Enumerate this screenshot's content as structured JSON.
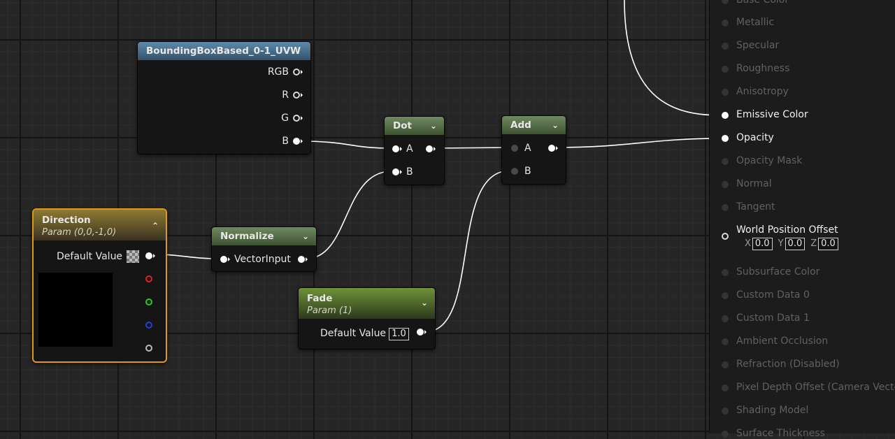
{
  "nodes": {
    "bbox": {
      "title": "BoundingBoxBased_0-1_UVW",
      "outputs": [
        "RGB",
        "R",
        "G",
        "B"
      ],
      "header_color": "#4a6f8a"
    },
    "dot": {
      "title": "Dot",
      "inputs": [
        "A",
        "B"
      ],
      "header_color": "#55694a"
    },
    "add": {
      "title": "Add",
      "inputs": [
        "A",
        "B"
      ],
      "header_color": "#55694a"
    },
    "direction": {
      "title": "Direction",
      "subtitle": "Param (0,0,-1,0)",
      "default_label": "Default Value",
      "header_color": "#7a6a2a",
      "border_color": "#e0981c"
    },
    "normalize": {
      "title": "Normalize",
      "input": "VectorInput",
      "header_color": "#55694a"
    },
    "fade": {
      "title": "Fade",
      "subtitle": "Param (1)",
      "default_label": "Default Value",
      "default_value": "1.0",
      "header_color": "#5a7a2a"
    }
  },
  "panel": {
    "inputs": [
      {
        "label": "Base Color",
        "active": false
      },
      {
        "label": "Metallic",
        "active": false
      },
      {
        "label": "Specular",
        "active": false
      },
      {
        "label": "Roughness",
        "active": false
      },
      {
        "label": "Anisotropy",
        "active": false
      },
      {
        "label": "Emissive Color",
        "active": true
      },
      {
        "label": "Opacity",
        "active": true
      },
      {
        "label": "Opacity Mask",
        "active": false
      },
      {
        "label": "Normal",
        "active": false
      },
      {
        "label": "Tangent",
        "active": false
      },
      {
        "label": "World Position Offset",
        "active": true
      },
      {
        "label": "Subsurface Color",
        "active": false
      },
      {
        "label": "Custom Data 0",
        "active": false
      },
      {
        "label": "Custom Data 1",
        "active": false
      },
      {
        "label": "Ambient Occlusion",
        "active": false
      },
      {
        "label": "Refraction (Disabled)",
        "active": false
      },
      {
        "label": "Pixel Depth Offset (Camera Vector)",
        "active": false
      },
      {
        "label": "Shading Model",
        "active": false
      },
      {
        "label": "Surface Thickness",
        "active": false
      }
    ],
    "wpo": {
      "x_label": "X",
      "x": "0.0",
      "y_label": "Y",
      "y": "0.0",
      "z_label": "Z",
      "z": "0.0"
    }
  },
  "icons": {
    "collapse": "chevron-down-icon",
    "expand": "chevron-up-icon"
  }
}
